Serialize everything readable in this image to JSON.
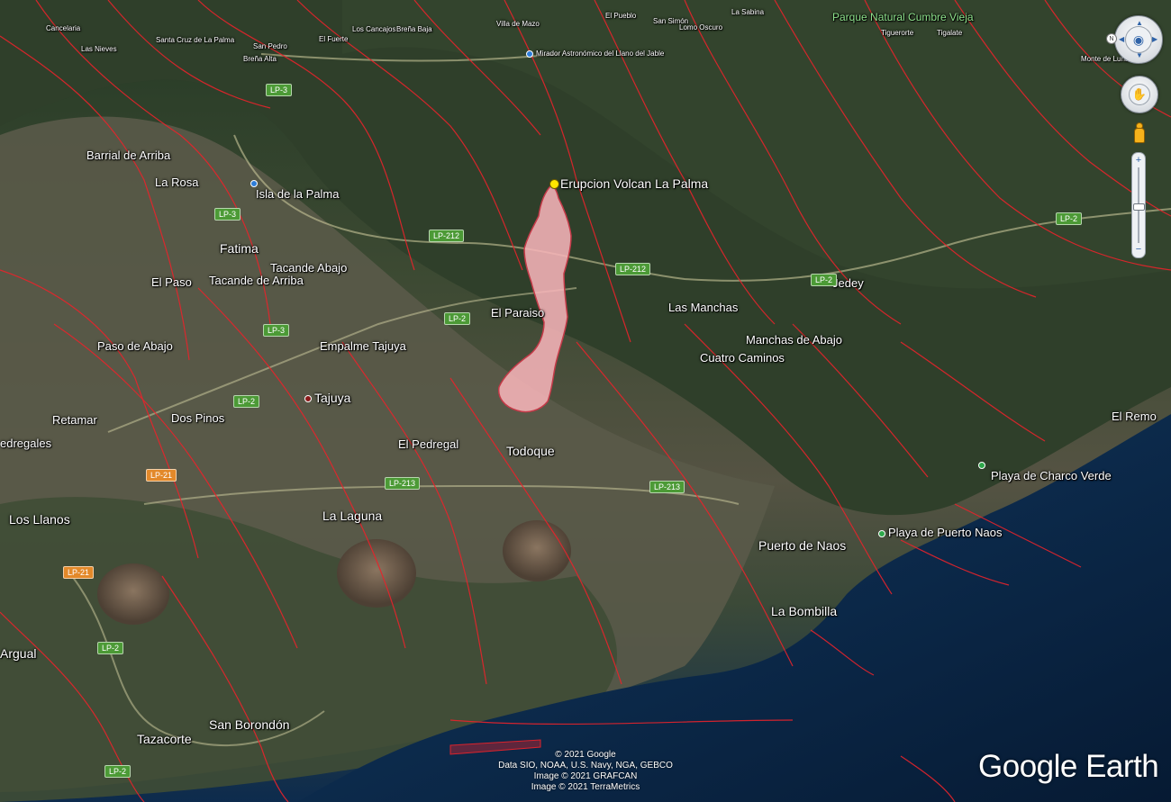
{
  "overlay": {
    "label": "Erupcion Volcan La Palma",
    "fill": "#f6b4b8",
    "stroke": "#c43a48"
  },
  "colors": {
    "fault_lines": "#e8232b",
    "sea": "#0d2b4d",
    "park_label": "#8ee28c"
  },
  "places": [
    {
      "name": "Cancelaria",
      "size": "small",
      "marker": "none"
    },
    {
      "name": "Las Nieves",
      "size": "small",
      "marker": "none"
    },
    {
      "name": "Santa Cruz de La Palma",
      "size": "small",
      "marker": "none"
    },
    {
      "name": "San Pedro",
      "size": "small",
      "marker": "none"
    },
    {
      "name": "El Fuerte",
      "size": "small",
      "marker": "none"
    },
    {
      "name": "Los Cancajos",
      "size": "small",
      "marker": "none"
    },
    {
      "name": "Breña Baja",
      "size": "small",
      "marker": "none"
    },
    {
      "name": "Breña Alta",
      "size": "small",
      "marker": "none"
    },
    {
      "name": "Villa de Mazo",
      "size": "small",
      "marker": "none"
    },
    {
      "name": "El Pueblo",
      "size": "small",
      "marker": "none"
    },
    {
      "name": "San Simón",
      "size": "small",
      "marker": "none"
    },
    {
      "name": "La Sabina",
      "size": "small",
      "marker": "none"
    },
    {
      "name": "Lomo Oscuro",
      "size": "small",
      "marker": "none"
    },
    {
      "name": "Tigalate",
      "size": "small",
      "marker": "none"
    },
    {
      "name": "Tiguerorte",
      "size": "small",
      "marker": "none"
    },
    {
      "name": "Monte de Luna",
      "size": "small",
      "marker": "none"
    },
    {
      "name": "Mirador Astronómico del Llano del Jable",
      "size": "small",
      "marker": "blue"
    },
    {
      "name": "Barrial de Arriba",
      "size": "medium",
      "marker": "red"
    },
    {
      "name": "La Rosa",
      "size": "medium",
      "marker": "none"
    },
    {
      "name": "Isla de la Palma",
      "size": "medium",
      "marker": "blue"
    },
    {
      "name": "Fatima",
      "size": "large",
      "marker": "red"
    },
    {
      "name": "Tacande Abajo",
      "size": "medium",
      "marker": "none"
    },
    {
      "name": "El Paso",
      "size": "medium",
      "marker": "red"
    },
    {
      "name": "Tacande de Arriba",
      "size": "medium",
      "marker": "none"
    },
    {
      "name": "Paso de Abajo",
      "size": "medium",
      "marker": "red"
    },
    {
      "name": "Empalme Tajuya",
      "size": "medium",
      "marker": "none"
    },
    {
      "name": "Tajuya",
      "size": "large",
      "marker": "red"
    },
    {
      "name": "El Paraiso",
      "size": "medium",
      "marker": "none"
    },
    {
      "name": "Las Manchas",
      "size": "medium",
      "marker": "none"
    },
    {
      "name": "Manchas de Abajo",
      "size": "medium",
      "marker": "none"
    },
    {
      "name": "Cuatro Caminos",
      "size": "medium",
      "marker": "none"
    },
    {
      "name": "Jedey",
      "size": "medium",
      "marker": "red"
    },
    {
      "name": "Retamar",
      "size": "medium",
      "marker": "red"
    },
    {
      "name": "Dos Pinos",
      "size": "medium",
      "marker": "red"
    },
    {
      "name": "edregales",
      "size": "medium",
      "marker": "none"
    },
    {
      "name": "El Pedregal",
      "size": "medium",
      "marker": "red"
    },
    {
      "name": "Todoque",
      "size": "large",
      "marker": "none"
    },
    {
      "name": "El Remo",
      "size": "medium",
      "marker": "red"
    },
    {
      "name": "Playa de Charco Verde",
      "size": "medium",
      "marker": "green"
    },
    {
      "name": "Los Llanos",
      "size": "large",
      "marker": "red"
    },
    {
      "name": "La Laguna",
      "size": "large",
      "marker": "red"
    },
    {
      "name": "Puerto de Naos",
      "size": "large",
      "marker": "red"
    },
    {
      "name": "Playa de Puerto Naos",
      "size": "medium",
      "marker": "green"
    },
    {
      "name": "La Bombilla",
      "size": "large",
      "marker": "red"
    },
    {
      "name": "Argual",
      "size": "large",
      "marker": "red"
    },
    {
      "name": "San Borondón",
      "size": "large",
      "marker": "red"
    },
    {
      "name": "Tazacorte",
      "size": "large",
      "marker": "red"
    },
    {
      "name": "Parque Natural Cumbre Vieja",
      "size": "park",
      "marker": "none"
    }
  ],
  "roads": [
    {
      "id": "LP-3",
      "color": "green"
    },
    {
      "id": "LP-3",
      "color": "green"
    },
    {
      "id": "LP-3",
      "color": "green"
    },
    {
      "id": "LP-212",
      "color": "green"
    },
    {
      "id": "LP-212",
      "color": "green"
    },
    {
      "id": "LP-2",
      "color": "green"
    },
    {
      "id": "LP-2",
      "color": "green"
    },
    {
      "id": "LP-2",
      "color": "green"
    },
    {
      "id": "LP-2",
      "color": "green"
    },
    {
      "id": "LP-21",
      "color": "orange"
    },
    {
      "id": "LP-213",
      "color": "green"
    },
    {
      "id": "LP-213",
      "color": "green"
    },
    {
      "id": "LP-21",
      "color": "orange"
    },
    {
      "id": "LP-2",
      "color": "green"
    },
    {
      "id": "LP-2",
      "color": "green"
    }
  ],
  "nav": {
    "north": "N",
    "zoom_in": "+",
    "zoom_out": "−",
    "move_icon": "eye-icon",
    "look_icon": "hand-icon"
  },
  "copyright": [
    "© 2021 Google",
    "Data SIO, NOAA, U.S. Navy, NGA, GEBCO",
    "Image © 2021 GRAFCAN",
    "Image © 2021 TerraMetrics"
  ],
  "brand": "Google Earth"
}
